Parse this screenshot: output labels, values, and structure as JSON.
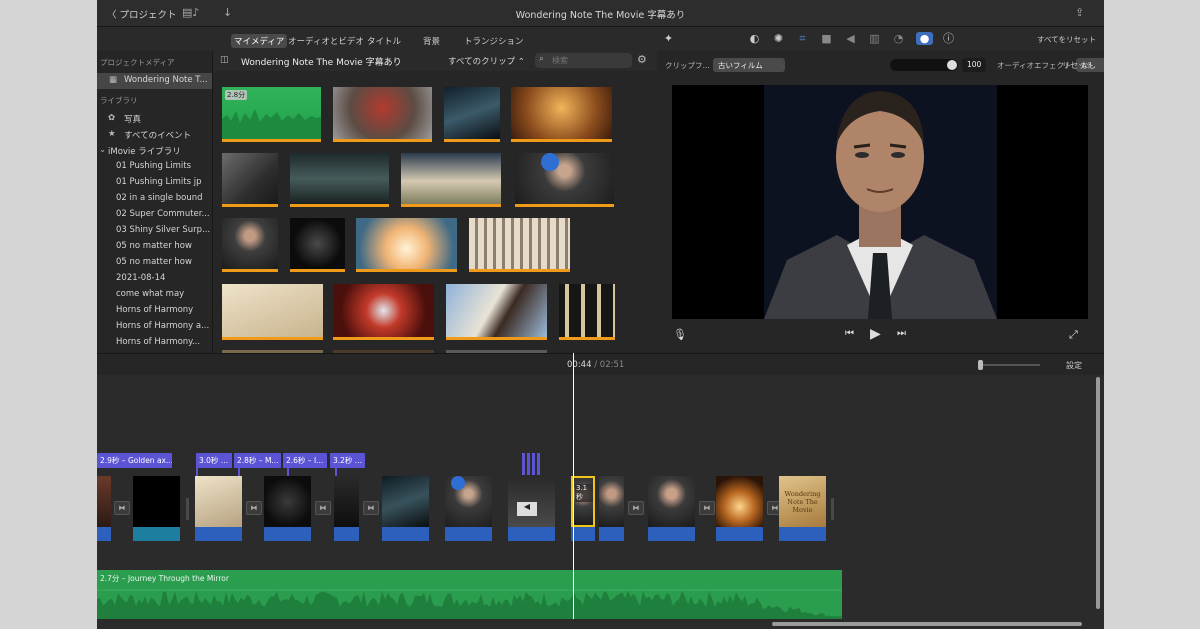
{
  "titlebar": {
    "back_label": "〈 プロジェクト",
    "title": "Wondering Note The Movie 字幕あり"
  },
  "media_tabs": [
    "マイメディア",
    "オーディオとビデオ",
    "タイトル",
    "背景",
    "トランジション"
  ],
  "sidebar": {
    "project_media_header": "プロジェクトメディア",
    "project_item": "Wondering Note T...",
    "library_header": "ライブラリ",
    "photos": "写真",
    "all_events": "すべてのイベント",
    "imovie_library": "iMovie ライブラリ",
    "events": [
      "01 Pushing Limits",
      "01 Pushing Limits jp",
      "02 in a single bound",
      "02 Super Commuter...",
      "03 Shiny Silver Surp...",
      "05 no matter how",
      "05 no matter how",
      "2021-08-14",
      "come what may",
      "Horns of Harmony",
      "Horns of Harmony a...",
      "Horns of Harmony..."
    ]
  },
  "browser": {
    "event_title": "Wondering Note The Movie 字幕あり",
    "clip_filter": "すべてのクリップ ⌃",
    "search_placeholder": "検索",
    "first_clip_duration": "2.8分"
  },
  "viewer": {
    "reset_all": "すべてをリセット",
    "clip_filter_label": "クリップフ…",
    "clip_filter_value": "古いフィルム",
    "amount_value": "100",
    "audio_effect_label": "オーディオエフェクト:",
    "audio_effect_value": "なし",
    "reset": "リセット"
  },
  "timeline": {
    "current_time": "00:44",
    "separator": "/",
    "total_time": "02:51",
    "settings": "設定",
    "title_clips": [
      "2.9秒 – Golden ax...",
      "3.0秒 ...",
      "2.8秒 – M...",
      "2.6秒 – I...",
      "3.2秒 ..."
    ],
    "selected_clip_duration": "3.1秒",
    "audio_clip_label": "2.7分 – Journey Through the Mirror",
    "poster_text": "Wondering Note The Movie"
  },
  "colors": {
    "accent_orange": "#f09a1a",
    "title_purple": "#5b55d6",
    "clip_blue": "#2d5fbd",
    "audio_green": "#2a9d4e"
  }
}
